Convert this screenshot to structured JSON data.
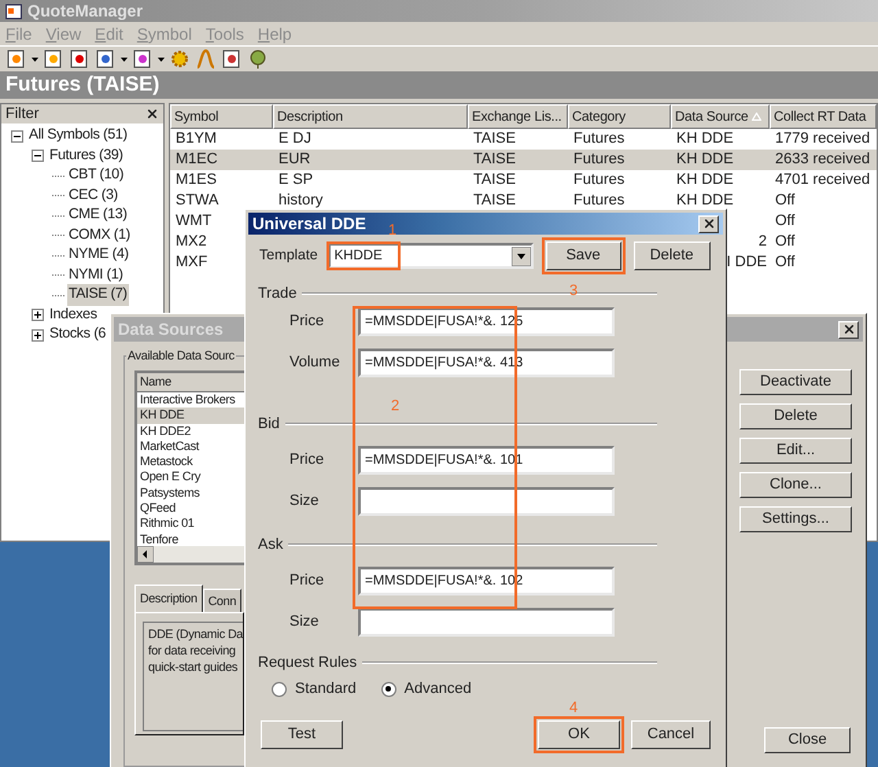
{
  "app": {
    "title": "QuoteManager"
  },
  "menu": [
    "File",
    "View",
    "Edit",
    "Symbol",
    "Tools",
    "Help"
  ],
  "header": "Futures (TAISE)",
  "filter": {
    "title": "Filter",
    "tree": [
      {
        "label": "All Symbols",
        "count": "(51)",
        "expanded": true,
        "selected": false,
        "children": [
          {
            "label": "Futures",
            "count": "(39)",
            "expanded": true,
            "selected": false,
            "children": [
              {
                "label": "CBT",
                "count": "(10)",
                "selected": false
              },
              {
                "label": "CEC",
                "count": "(3)",
                "selected": false
              },
              {
                "label": "CME",
                "count": "(13)",
                "selected": false
              },
              {
                "label": "COMX",
                "count": "(1)",
                "selected": false
              },
              {
                "label": "NYME",
                "count": "(4)",
                "selected": false
              },
              {
                "label": "NYMI",
                "count": "(1)",
                "selected": false
              },
              {
                "label": "TAISE",
                "count": "(7)",
                "selected": true
              }
            ]
          },
          {
            "label": "Indexes",
            "expanded": false,
            "selected": false
          },
          {
            "label": "Stocks",
            "count": "(6",
            "expanded": false,
            "selected": false
          }
        ]
      }
    ]
  },
  "table": {
    "columns": [
      {
        "label": "Symbol",
        "sorted": false
      },
      {
        "label": "Description",
        "sorted": false
      },
      {
        "label": "Exchange Lis...",
        "sorted": false
      },
      {
        "label": "Category",
        "sorted": false
      },
      {
        "label": "Data Source",
        "sorted": true
      },
      {
        "label": "Collect RT Data",
        "sorted": false
      }
    ],
    "rows": [
      {
        "kind": "full",
        "selected": false,
        "cells": [
          "B1YM",
          "E DJ",
          "TAISE",
          "Futures",
          "KH DDE",
          "1779 received"
        ]
      },
      {
        "kind": "full",
        "selected": true,
        "cells": [
          "M1EC",
          "EUR",
          "TAISE",
          "Futures",
          "KH DDE",
          "2633 received"
        ]
      },
      {
        "kind": "full",
        "selected": false,
        "cells": [
          "M1ES",
          "E SP",
          "TAISE",
          "Futures",
          "KH DDE",
          "4701 received"
        ]
      },
      {
        "kind": "full",
        "selected": false,
        "cells": [
          "STWA",
          "history",
          "TAISE",
          "Futures",
          "KH DDE",
          "Off"
        ]
      },
      {
        "kind": "covered",
        "selected": false,
        "symbol": "WMT",
        "collect": "Off"
      },
      {
        "kind": "covered",
        "selected": false,
        "symbol": "MX2",
        "data_source": "2",
        "collect": "Off"
      },
      {
        "kind": "covered",
        "selected": false,
        "symbol": "MXF",
        "data_source": "I DDE",
        "collect": "Off"
      }
    ]
  },
  "data_sources": {
    "title": "Data Sources",
    "group": "Available Data Sourc",
    "list_header": "Name",
    "items": [
      {
        "label": "Interactive Brokers",
        "selected": false
      },
      {
        "label": "KH DDE",
        "selected": true
      },
      {
        "label": "KH DDE2",
        "selected": false
      },
      {
        "label": "MarketCast",
        "selected": false
      },
      {
        "label": "Metastock",
        "selected": false
      },
      {
        "label": "Open E Cry",
        "selected": false
      },
      {
        "label": "Patsystems",
        "selected": false
      },
      {
        "label": "QFeed",
        "selected": false
      },
      {
        "label": "Rithmic 01",
        "selected": false
      },
      {
        "label": "Tenfore",
        "selected": false
      }
    ],
    "tabs": [
      {
        "label": "Description",
        "selected": true
      },
      {
        "label": "Conn",
        "selected": false
      }
    ],
    "description": [
      "DDE (Dynamic Da",
      "for data receiving",
      "quick-start guides"
    ],
    "buttons": [
      "Deactivate",
      "Delete",
      "Edit...",
      "Clone...",
      "Settings..."
    ],
    "close_button": "Close"
  },
  "universal_dde": {
    "title": "Universal DDE",
    "template": {
      "label": "Template",
      "value": "KHDDE"
    },
    "save": "Save",
    "delete": "Delete",
    "sections": [
      {
        "title": "Trade",
        "fields": [
          {
            "label": "Price",
            "value": "=MMSDDE|FUSA!*&. 125"
          },
          {
            "label": "Volume",
            "value": "=MMSDDE|FUSA!*&. 413"
          }
        ]
      },
      {
        "title": "Bid",
        "fields": [
          {
            "label": "Price",
            "value": "=MMSDDE|FUSA!*&. 101"
          },
          {
            "label": "Size"
          }
        ]
      },
      {
        "title": "Ask",
        "fields": [
          {
            "label": "Price",
            "value": "=MMSDDE|FUSA!*&. 102"
          },
          {
            "label": "Size"
          }
        ]
      }
    ],
    "request_rules": {
      "title": "Request Rules",
      "options": [
        {
          "label": "Standard",
          "selected": false
        },
        {
          "label": "Advanced",
          "selected": true
        }
      ]
    },
    "buttons": [
      "Test",
      "OK",
      "Cancel"
    ],
    "annotations": [
      "1",
      "2",
      "3",
      "4"
    ]
  }
}
